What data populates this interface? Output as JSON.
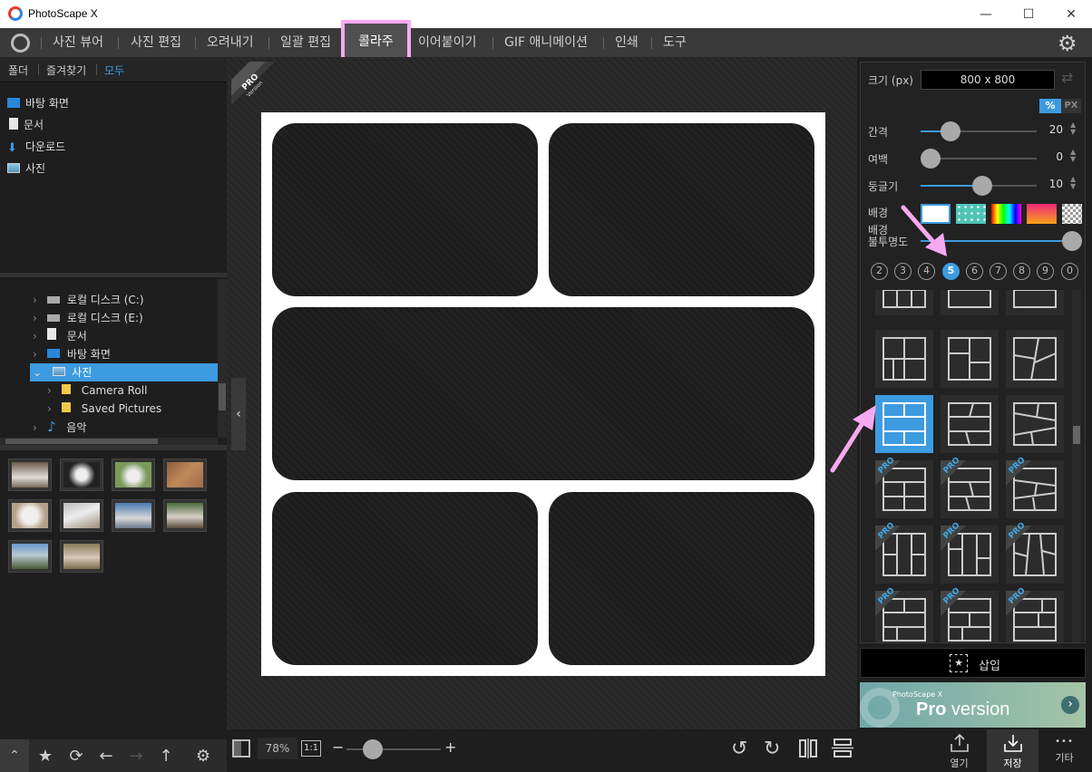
{
  "window": {
    "title": "PhotoScape X",
    "minimize": "—",
    "maximize": "☐",
    "close": "✕"
  },
  "menu": {
    "items": [
      "사진 뷰어",
      "사진 편집",
      "오려내기",
      "일괄 편집",
      "콜라주",
      "이어붙이기",
      "GIF 애니메이션",
      "인쇄",
      "도구"
    ],
    "active": "콜라주"
  },
  "left_panel": {
    "tabs": [
      "폴더",
      "즐겨찾기",
      "모두"
    ],
    "active_tab": "모두",
    "quick_access": [
      "바탕 화면",
      "문서",
      "다운로드",
      "사진"
    ],
    "tree": [
      "로컬 디스크 (C:)",
      "로컬 디스크 (E:)",
      "문서",
      "바탕 화면",
      "사진",
      "Camera Roll",
      "Saved Pictures",
      "음악"
    ],
    "tree_selected": "사진"
  },
  "center": {
    "pro_badge": "PRO",
    "pro_badge_sub": "Version",
    "zoom": "78%",
    "one_to_one": "1:1",
    "zoom_minus": "−",
    "zoom_plus": "+",
    "zoom_level": 0.28
  },
  "right_panel": {
    "size_label": "크기 (px)",
    "size_value": "800 x 800",
    "unit_percent": "%",
    "unit_px": "PX",
    "spacing_label": "간격",
    "spacing_value": "20",
    "margin_label": "여백",
    "margin_value": "0",
    "roundness_label": "둥글기",
    "roundness_value": "10",
    "background_label": "배경",
    "opacity_label_1": "배경",
    "opacity_label_2": "불투명도",
    "counts": [
      "2",
      "3",
      "4",
      "5",
      "6",
      "7",
      "8",
      "9",
      "0"
    ],
    "selected_count": "5",
    "pro_tag": "PRO",
    "insert_label": "삽입",
    "insert_icon": "★",
    "pro_banner_small": "PhotoScape X",
    "pro_banner_big": "Pro",
    "pro_banner_rest": " version",
    "open_label": "열기",
    "save_label": "저장",
    "more_label": "기타",
    "more_icon": "•••"
  },
  "colors": {
    "accent": "#3d9be0",
    "highlight": "#f7a9f0",
    "background": "#1e1e1e"
  }
}
